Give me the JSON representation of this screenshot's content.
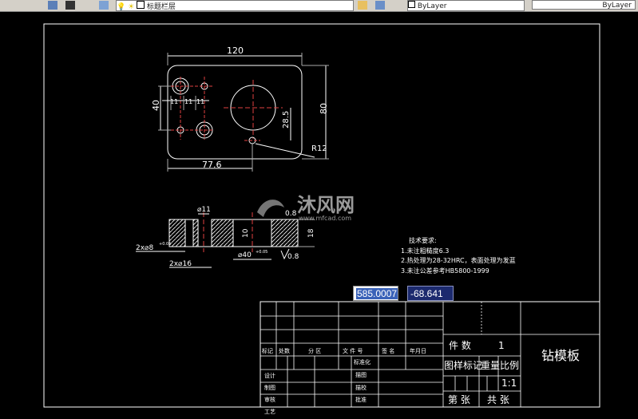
{
  "toolbar": {
    "layer_name": "标题栏层",
    "color_value": "ByLayer",
    "lineweight_value": "ByLayer"
  },
  "drawing": {
    "plan_dims": {
      "width": "120",
      "height": "80",
      "hole_offset": "40",
      "spacing_a": "11",
      "spacing_b": "11",
      "spacing_c": "11",
      "bore_height": "28.5",
      "radius": "R12",
      "bottom": "77.6"
    },
    "section_dims": {
      "top_dia": "⌀11",
      "flatness": "0.8",
      "small_hole": "2x⌀8",
      "small_tol": "+0.05",
      "left_depth": "2x⌀16",
      "height_a": "10",
      "bore": "⌀40",
      "bore_tol": "+0.05",
      "height_b": "18",
      "rough": "0.8"
    },
    "notes": {
      "title": "技术要求:",
      "lines": [
        "1.未注粗糙度6.3",
        "2.热处理为28-32HRC，表面处理为发蓝",
        "3.未注公差参考HB5800-1999"
      ]
    },
    "watermark": "沐风网",
    "watermark_url": "www.mfcad.com"
  },
  "coords": {
    "x": "585.0007",
    "y": "-68.641"
  },
  "title_block": {
    "row_headers": [
      "标记",
      "处数",
      "分 区",
      "文 件 号",
      "签 名",
      "年月日"
    ],
    "left_labels": [
      "设计",
      "制图",
      "审核",
      "工艺"
    ],
    "mid_labels": [
      "标准化",
      "描图",
      "描校",
      "批准"
    ],
    "count_label": "件 数",
    "count_value": "1",
    "marking_label": "图样标记",
    "weight_label": "重量",
    "scale_label": "比例",
    "scale_value": "1:1",
    "sheet_label": "第 张",
    "total_label": "共 张",
    "drawing_title": "钻模板"
  }
}
